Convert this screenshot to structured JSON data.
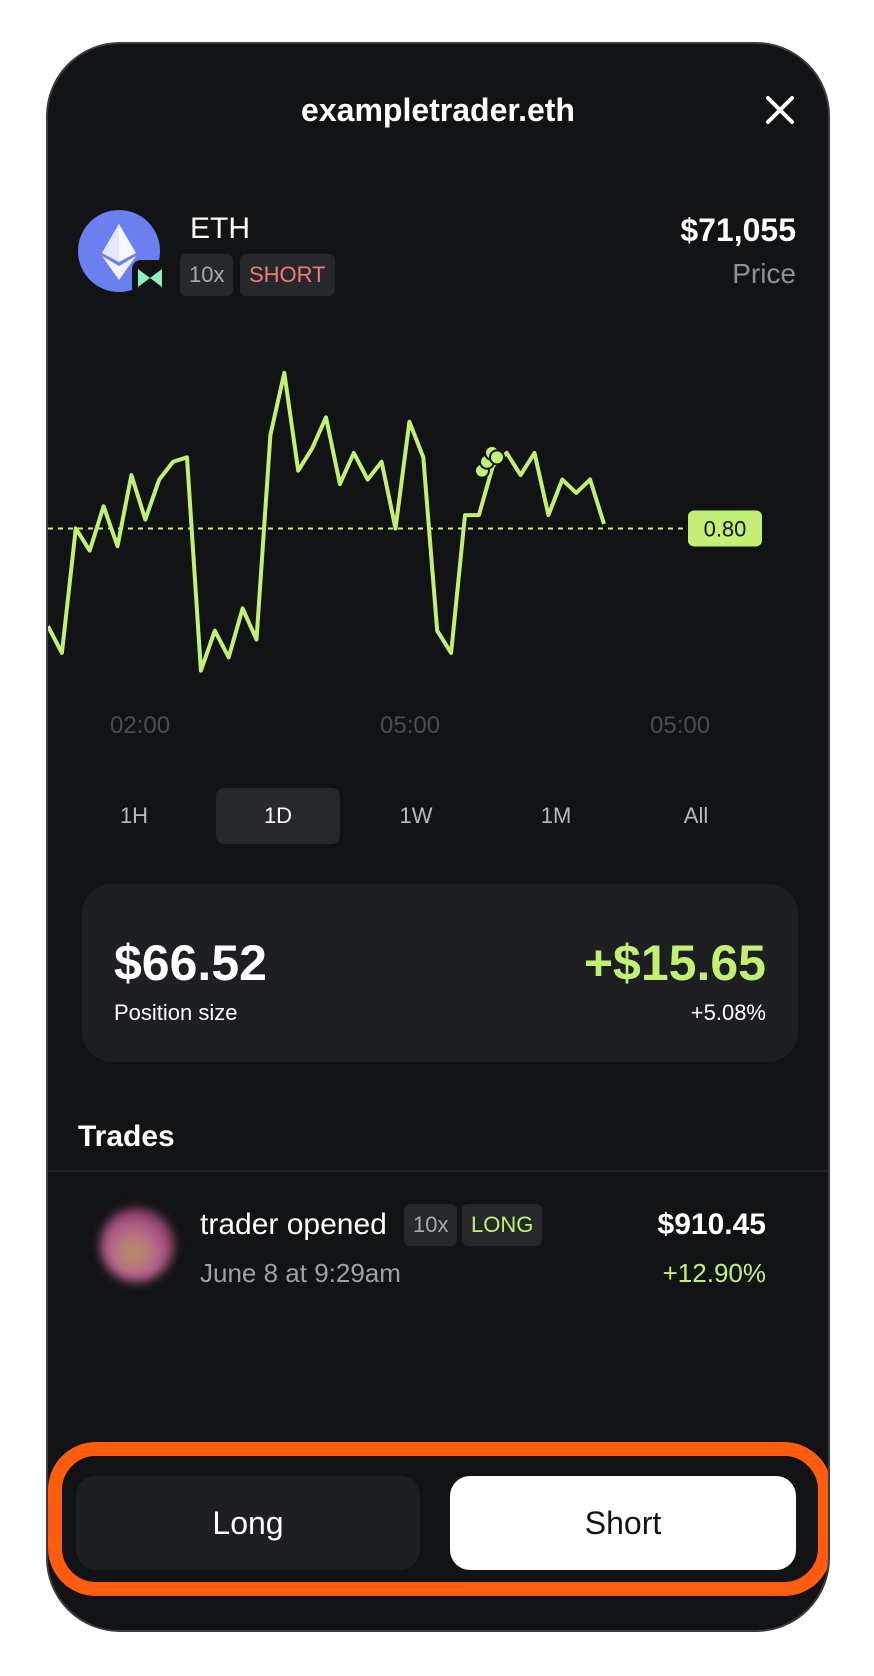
{
  "header": {
    "title": "exampletrader.eth"
  },
  "icons": {
    "close": "close-icon",
    "coin": "ethereum-icon",
    "protocol": "protocol-logo-icon"
  },
  "asset": {
    "name": "ETH",
    "leverage": "10x",
    "side": "SHORT",
    "price": "$71,055",
    "price_label": "Price"
  },
  "chart_data": {
    "type": "line",
    "color": "#c3f073",
    "reference_label": "0.80",
    "x_ticks": [
      "02:00",
      "05:00",
      "05:00"
    ],
    "series": [
      {
        "values": [
          0.58,
          0.52,
          0.8,
          0.75,
          0.85,
          0.76,
          0.92,
          0.82,
          0.91,
          0.95,
          0.96,
          0.48,
          0.57,
          0.51,
          0.62,
          0.55,
          1.01,
          1.15,
          0.93,
          0.98,
          1.05,
          0.9,
          0.97,
          0.91,
          0.95,
          0.8,
          1.04,
          0.96,
          0.57,
          0.52,
          0.83,
          0.83,
          0.94,
          0.97,
          0.92,
          0.97,
          0.83,
          0.91,
          0.88,
          0.91,
          0.81
        ]
      }
    ],
    "markers": [
      0.93,
      0.95,
      0.97,
      0.96
    ]
  },
  "ranges": {
    "items": [
      "1H",
      "1D",
      "1W",
      "1M",
      "All"
    ],
    "active": "1D"
  },
  "position": {
    "size": "$66.52",
    "size_label": "Position size",
    "pnl": "+$15.65",
    "pnl_pct": "+5.08%"
  },
  "trades": {
    "title": "Trades",
    "items": [
      {
        "title": "trader opened",
        "leverage": "10x",
        "side": "LONG",
        "date": "June 8 at 9:29am",
        "amount": "$910.45",
        "pct": "+12.90%"
      }
    ]
  },
  "actions": {
    "long_label": "Long",
    "short_label": "Short"
  },
  "colors": {
    "accent": "#c3f073",
    "short": "#f07b7b",
    "highlight": "#ff5c10",
    "background": "#121315"
  }
}
